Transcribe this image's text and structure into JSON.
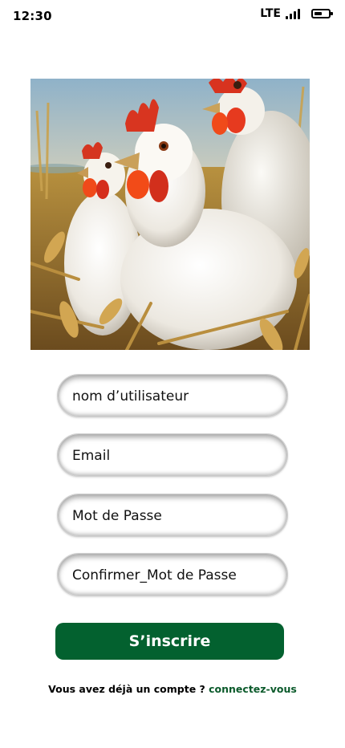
{
  "status_bar": {
    "time": "12:30",
    "network": "LTE",
    "signal_bars": 4,
    "battery_level": 0.55
  },
  "hero": {
    "icon": "chickens-photo"
  },
  "form": {
    "username_placeholder": "nom d’utilisateur",
    "email_placeholder": "Email",
    "password_placeholder": "Mot de Passe",
    "confirm_password_placeholder": "Confirmer_Mot de Passe",
    "submit_label": "S’inscrire"
  },
  "footer": {
    "prompt": "Vous avez déjà un compte ?",
    "login_link": "connectez-vous"
  },
  "colors": {
    "primary": "#03612f",
    "link": "#0b5a2b"
  }
}
